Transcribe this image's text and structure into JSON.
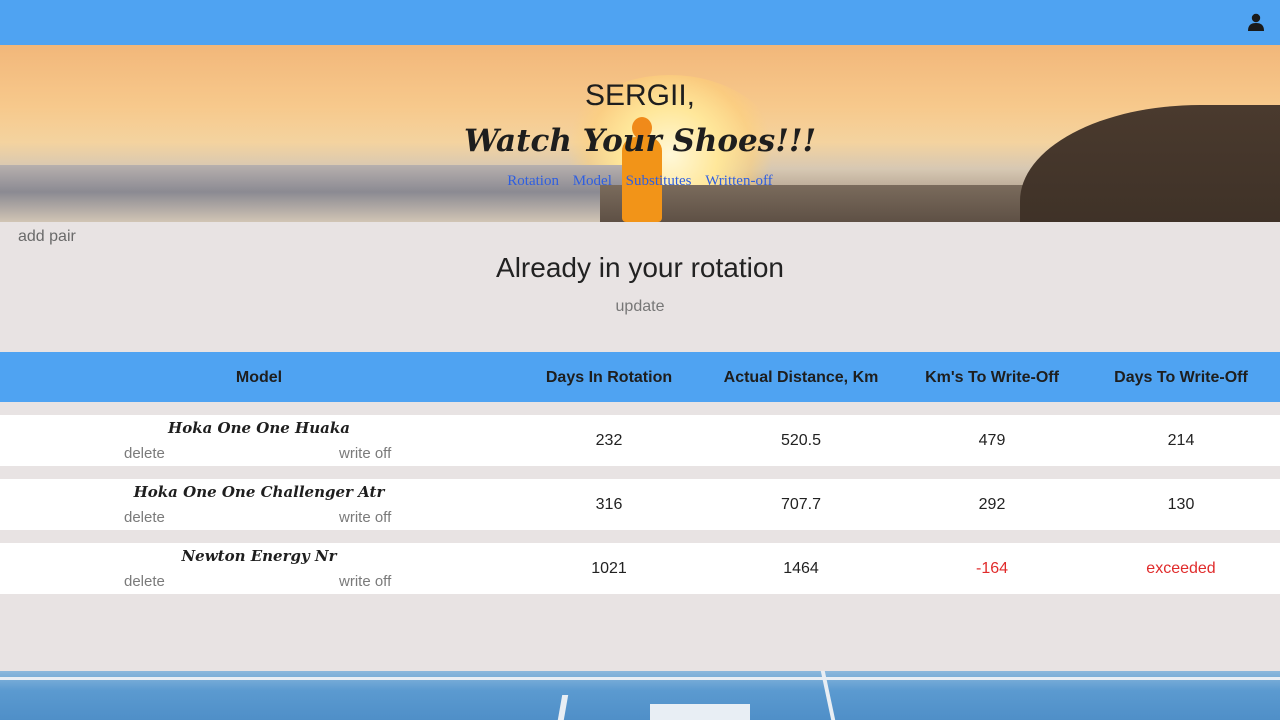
{
  "header": {
    "user_icon": "user-icon"
  },
  "hero": {
    "name": "SERGII,",
    "tagline": "Watch Your Shoes!!!",
    "nav": [
      "Rotation",
      "Model",
      "Substitutes",
      "Written-off"
    ]
  },
  "actions": {
    "add_pair": "add pair",
    "update": "update"
  },
  "section_title": "Already in your rotation",
  "table": {
    "headers": [
      "Model",
      "Days In Rotation",
      "Actual Distance, Km",
      "Km's To Write-Off",
      "Days To Write-Off"
    ],
    "row_actions": {
      "delete": "delete",
      "write_off": "write off"
    },
    "rows": [
      {
        "model": "Hoka One One Huaka",
        "days": "232",
        "distance": "520.5",
        "km_left": "479",
        "days_left": "214"
      },
      {
        "model": "Hoka One One Challenger Atr",
        "days": "316",
        "distance": "707.7",
        "km_left": "292",
        "days_left": "130"
      },
      {
        "model": "Newton Energy Nr",
        "days": "1021",
        "distance": "1464",
        "km_left": "-164",
        "days_left": "exceeded"
      }
    ]
  },
  "colors": {
    "accent": "#4fa3f2",
    "background": "#e8e3e3",
    "warning": "#e02b2b",
    "link": "#2f5fe0"
  }
}
